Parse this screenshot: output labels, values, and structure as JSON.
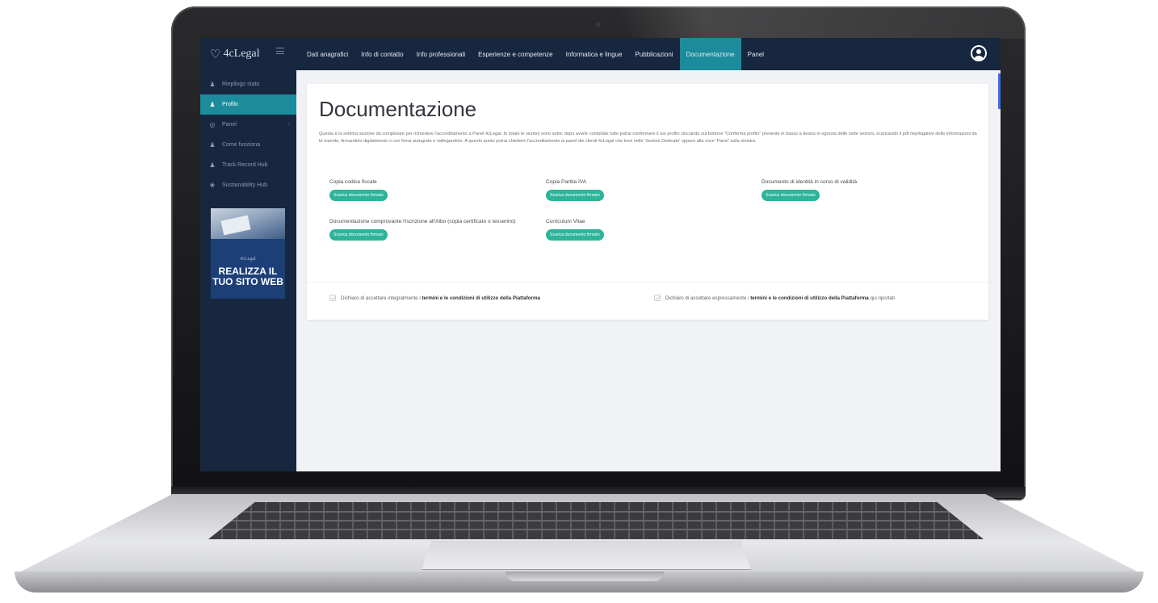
{
  "brand": {
    "mark": "♡",
    "name": "4cLegal"
  },
  "topnav": {
    "tabs": [
      {
        "label": "Dati anagrafici",
        "active": false
      },
      {
        "label": "Info di contatto",
        "active": false
      },
      {
        "label": "Info professionali",
        "active": false
      },
      {
        "label": "Esperienze e competenze",
        "active": false
      },
      {
        "label": "Informatica e lingue",
        "active": false
      },
      {
        "label": "Pubblicazioni",
        "active": false
      },
      {
        "label": "Documentazione",
        "active": true
      },
      {
        "label": "Panel",
        "active": false
      }
    ],
    "user_icon": "user-circle-icon"
  },
  "sidebar": {
    "items": [
      {
        "label": "Riepilogo stato",
        "icon": "user-icon",
        "active": false
      },
      {
        "label": "Profilo",
        "icon": "user-icon",
        "active": true
      },
      {
        "label": "Panel",
        "icon": "globe-icon",
        "active": false,
        "chevron": "‹"
      },
      {
        "label": "Come funziona",
        "icon": "user-icon",
        "active": false
      },
      {
        "label": "Track Record Hub",
        "icon": "user-icon",
        "active": false
      },
      {
        "label": "Sustainability Hub",
        "icon": "leaf-icon",
        "active": false
      }
    ],
    "promo": {
      "logo": "4cLegal",
      "text": "REALIZZA IL TUO SITO WEB"
    }
  },
  "main": {
    "title": "Documentazione",
    "intro": "Questa è la settima sezione da completare per richiedere l'accreditamento a Panel 4cLegal. In totale le sezioni sono sette: dopo averle compilate tutte potrai confermare il tuo profilo cliccando sul bottone \"Conferma profilo\" presente in basso a destra in ognuna delle sette sezioni, scaricando il pdf riepilogativo delle informazioni da te inserite, firmandolo digitalmente o con firma autografa e riallegandolo. A questo punto potrai chiedere l'accreditamento ai panel dei clienti 4cLegal che trovi nelle 'Sezioni Dedicate' oppure alla voce 'Panel' sulla sinistra.",
    "documents": [
      {
        "label": "Copia codice fiscale",
        "button": "Scarica documento firmato"
      },
      {
        "label": "Copia Partita IVA",
        "button": "Scarica documento firmato"
      },
      {
        "label": "Documento di identità in corso di validità",
        "button": "Scarica documento firmato"
      },
      {
        "label": "Documentazione comprovante l'iscrizione all'Albo (copia certificato o tesserino)",
        "button": "Scarica documento firmato"
      },
      {
        "label": "Curriculum Vitae",
        "button": "Scarica documento firmato"
      }
    ],
    "consents": [
      {
        "prefix": "Dichiaro di accettare integralmente i ",
        "link": "termini e le condizioni di utilizzo della Piattaforma",
        "suffix": "",
        "checked": true
      },
      {
        "prefix": "Dichiaro di accettare espressamente i ",
        "link": "termini e le condizioni di utilizzo della Piattaforma",
        "suffix": " qui riportati",
        "checked": true
      }
    ]
  },
  "colors": {
    "navy": "#16273f",
    "teal": "#1c8b9b",
    "green_button": "#2cb59a"
  }
}
